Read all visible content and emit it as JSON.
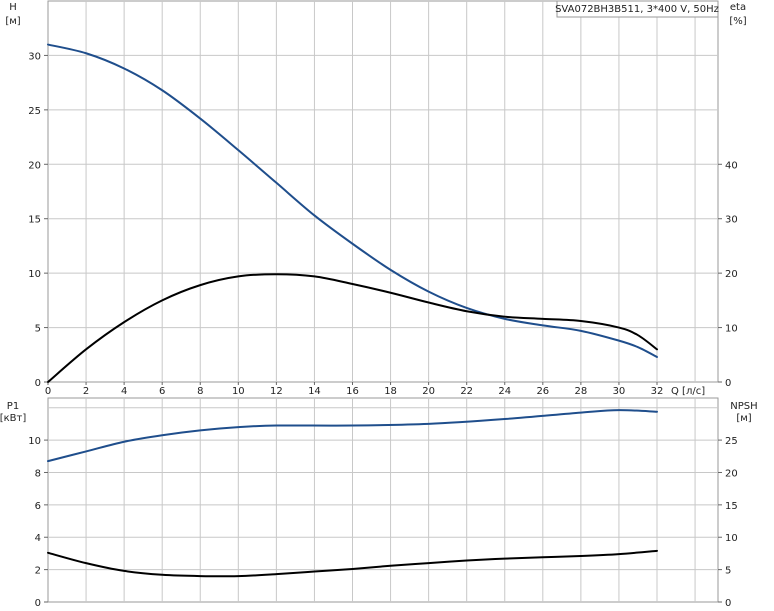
{
  "chart_data": [
    {
      "type": "line",
      "title": "SVA072BH3B511, 3*400 V, 50Hz",
      "x": {
        "label": "Q [л/с]",
        "lim": [
          0,
          32
        ],
        "ticks": [
          0,
          2,
          4,
          6,
          8,
          10,
          12,
          14,
          16,
          18,
          20,
          22,
          24,
          26,
          28,
          30,
          32
        ]
      },
      "y_left": {
        "label_top": "H",
        "label_unit": "[м]",
        "lim": [
          0,
          35
        ],
        "ticks": [
          0,
          5,
          10,
          15,
          20,
          25,
          30
        ]
      },
      "y_right": {
        "label_top": "eta",
        "label_unit": "[%]",
        "lim": [
          0,
          70
        ],
        "ticks": [
          0,
          10,
          20,
          30,
          40
        ]
      },
      "grid": true,
      "series": [
        {
          "axis": "left",
          "color": "#1f4e8c",
          "points": [
            [
              0,
              31.0
            ],
            [
              2,
              30.2
            ],
            [
              4,
              28.8
            ],
            [
              6,
              26.8
            ],
            [
              8,
              24.2
            ],
            [
              10,
              21.3
            ],
            [
              12,
              18.3
            ],
            [
              14,
              15.3
            ],
            [
              16,
              12.7
            ],
            [
              18,
              10.3
            ],
            [
              20,
              8.3
            ],
            [
              22,
              6.8
            ],
            [
              24,
              5.8
            ],
            [
              26,
              5.2
            ],
            [
              28,
              4.7
            ],
            [
              30,
              3.8
            ],
            [
              31,
              3.2
            ],
            [
              32,
              2.3
            ]
          ]
        },
        {
          "axis": "right",
          "color": "#000000",
          "points": [
            [
              0,
              0
            ],
            [
              2,
              6.0
            ],
            [
              4,
              11.0
            ],
            [
              6,
              15.0
            ],
            [
              8,
              17.8
            ],
            [
              10,
              19.4
            ],
            [
              12,
              19.8
            ],
            [
              14,
              19.4
            ],
            [
              16,
              18.0
            ],
            [
              18,
              16.4
            ],
            [
              20,
              14.6
            ],
            [
              22,
              13.0
            ],
            [
              24,
              12.0
            ],
            [
              26,
              11.6
            ],
            [
              28,
              11.2
            ],
            [
              30,
              10.0
            ],
            [
              31,
              8.6
            ],
            [
              32,
              6.0
            ]
          ]
        }
      ]
    },
    {
      "type": "line",
      "x": {
        "lim": [
          0,
          32
        ]
      },
      "y_left": {
        "label_top": "P1",
        "label_unit": "[кВт]",
        "lim": [
          0,
          12.6
        ],
        "ticks": [
          0,
          2,
          4,
          6,
          8,
          10
        ]
      },
      "y_right": {
        "label_top": "NPSH",
        "label_unit": "[м]",
        "lim": [
          0,
          31.5
        ],
        "ticks": [
          0,
          5,
          10,
          15,
          20,
          25
        ]
      },
      "grid": true,
      "series": [
        {
          "axis": "left",
          "color": "#1f4e8c",
          "points": [
            [
              0,
              8.7
            ],
            [
              2,
              9.3
            ],
            [
              4,
              9.9
            ],
            [
              6,
              10.3
            ],
            [
              8,
              10.6
            ],
            [
              10,
              10.8
            ],
            [
              12,
              10.9
            ],
            [
              16,
              10.9
            ],
            [
              20,
              11.0
            ],
            [
              24,
              11.3
            ],
            [
              28,
              11.7
            ],
            [
              30,
              11.85
            ],
            [
              32,
              11.75
            ]
          ]
        },
        {
          "axis": "right",
          "color": "#000000",
          "points": [
            [
              0,
              7.6
            ],
            [
              2,
              6.0
            ],
            [
              4,
              4.8
            ],
            [
              6,
              4.2
            ],
            [
              8,
              4.0
            ],
            [
              10,
              4.0
            ],
            [
              12,
              4.3
            ],
            [
              14,
              4.7
            ],
            [
              16,
              5.1
            ],
            [
              18,
              5.6
            ],
            [
              20,
              6.0
            ],
            [
              22,
              6.4
            ],
            [
              24,
              6.7
            ],
            [
              26,
              6.9
            ],
            [
              28,
              7.1
            ],
            [
              30,
              7.4
            ],
            [
              32,
              7.9
            ]
          ]
        }
      ]
    }
  ]
}
